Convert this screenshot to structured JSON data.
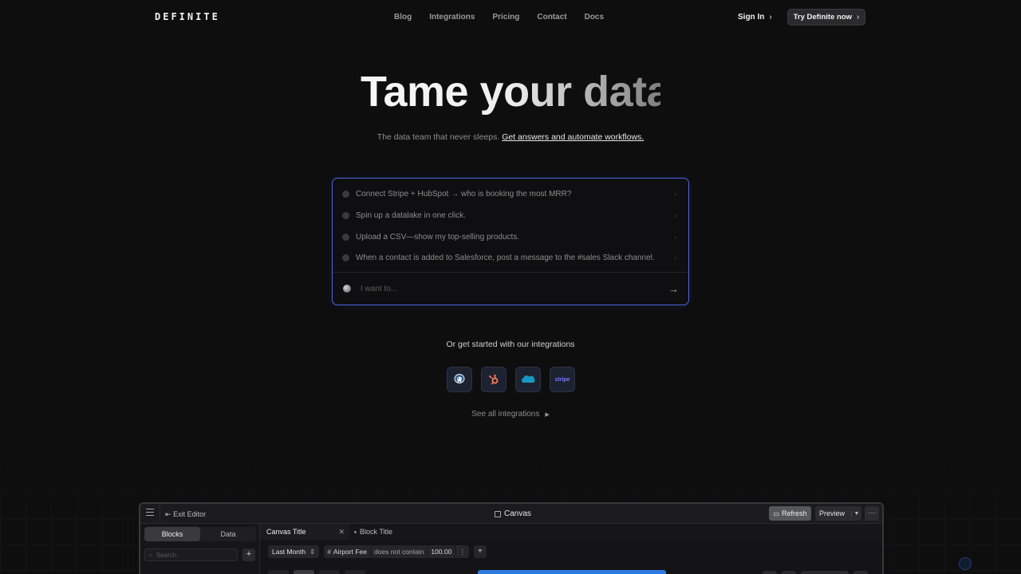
{
  "nav": {
    "logo": "DEFINITE",
    "links": [
      "Blog",
      "Integrations",
      "Pricing",
      "Contact",
      "Docs"
    ],
    "sign_in": "Sign In",
    "cta": "Try Definite now"
  },
  "hero": {
    "title": "Tame your data",
    "subtitle": "The data team that never sleeps.",
    "subtitle_link": "Get answers and automate workflows."
  },
  "prompt": {
    "suggestions": [
      "Connect Stripe + HubSpot → who is booking the most MRR?",
      "Spin up a datalake in one click.",
      "Upload a CSV—show my top-selling products.",
      "When a contact is added to Salesforce, post a message to the #sales Slack channel."
    ],
    "placeholder": "I want to..."
  },
  "integrations": {
    "title": "Or get started with our integrations",
    "icons": [
      "postgres-icon",
      "hubspot-icon",
      "salesforce-icon",
      "stripe-icon"
    ],
    "stripe_text": "stripe",
    "see_all": "See all integrations"
  },
  "app_preview": {
    "exit_editor": "Exit Editor",
    "canvas": "Canvas",
    "refresh": "Refresh",
    "preview": "Preview",
    "more": "···",
    "sidebar_tabs": [
      "Blocks",
      "Data"
    ],
    "search_placeholder": "Search",
    "tab_active": "Canvas Title",
    "tab_other": "Block Title",
    "filter_date": "Last Month",
    "filter_field": "Airport Fee",
    "filter_op": "does not contain",
    "filter_value": "100.00"
  },
  "colors": {
    "background": "#0e0e0f",
    "accent_border": "#4f62d9",
    "refresh_bg": "#56575b",
    "blue_bar": "#2d7be0"
  }
}
